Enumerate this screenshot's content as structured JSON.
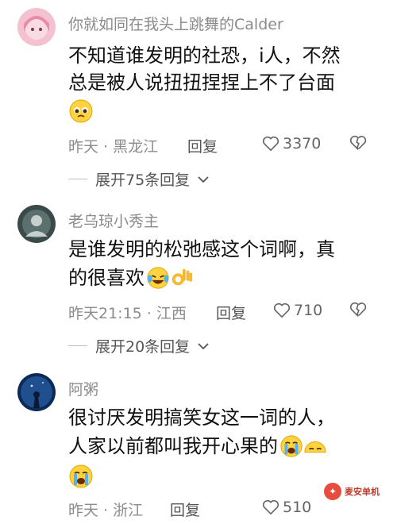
{
  "comments": [
    {
      "username": "你就如同在我头上跳舞的Calder",
      "lines": [
        "不知道谁发明的社恐，i人，不然",
        "总是被人说扭扭捏捏上不了台面"
      ],
      "meta": "昨天 · 黑龙江",
      "reply": "回复",
      "likes": "3370",
      "expand": "展开75条回复"
    },
    {
      "username": "老乌琼小秀主",
      "lines": [
        "是谁发明的松弛感这个词啊，真",
        "的很喜欢"
      ],
      "meta": "昨天21:15 · 江西",
      "reply": "回复",
      "likes": "710",
      "expand": "展开20条回复"
    },
    {
      "username": "阿粥",
      "lines": [
        "很讨厌发明搞笑女这一词的人，",
        "人家以前都叫我开心果的"
      ],
      "meta": "昨天 · 浙江",
      "reply": "回复",
      "likes": "510"
    }
  ],
  "watermark": "麦安单机",
  "icons": {
    "like": "heart-outline-icon",
    "dislike": "broken-heart-icon",
    "expand": "chevron-down-icon"
  },
  "colors": {
    "username": "#8a8a8a",
    "text": "#111111",
    "meta": "#8c8c8c"
  }
}
